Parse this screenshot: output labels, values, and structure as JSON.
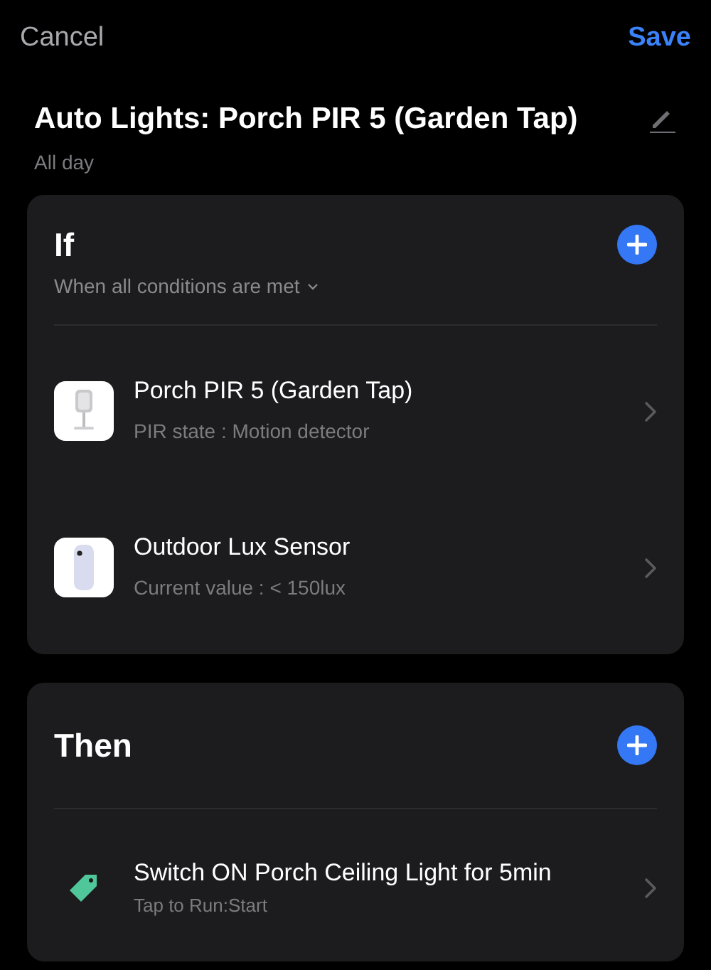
{
  "nav": {
    "cancel": "Cancel",
    "save": "Save"
  },
  "automation": {
    "title": "Auto Lights: Porch PIR 5 (Garden Tap)",
    "schedule": "All day"
  },
  "if_section": {
    "title": "If",
    "match_mode": "When all conditions are met",
    "conditions": [
      {
        "kind": "motion_sensor",
        "name": "Porch PIR 5 (Garden Tap)",
        "detail": "PIR state : Motion detector"
      },
      {
        "kind": "lux_sensor",
        "name": "Outdoor Lux Sensor",
        "detail": "Current value : < 150lux"
      }
    ]
  },
  "then_section": {
    "title": "Then",
    "actions": [
      {
        "kind": "scene",
        "name": "Switch ON Porch Ceiling Light for 5min",
        "detail": "Tap to Run:Start"
      }
    ]
  }
}
